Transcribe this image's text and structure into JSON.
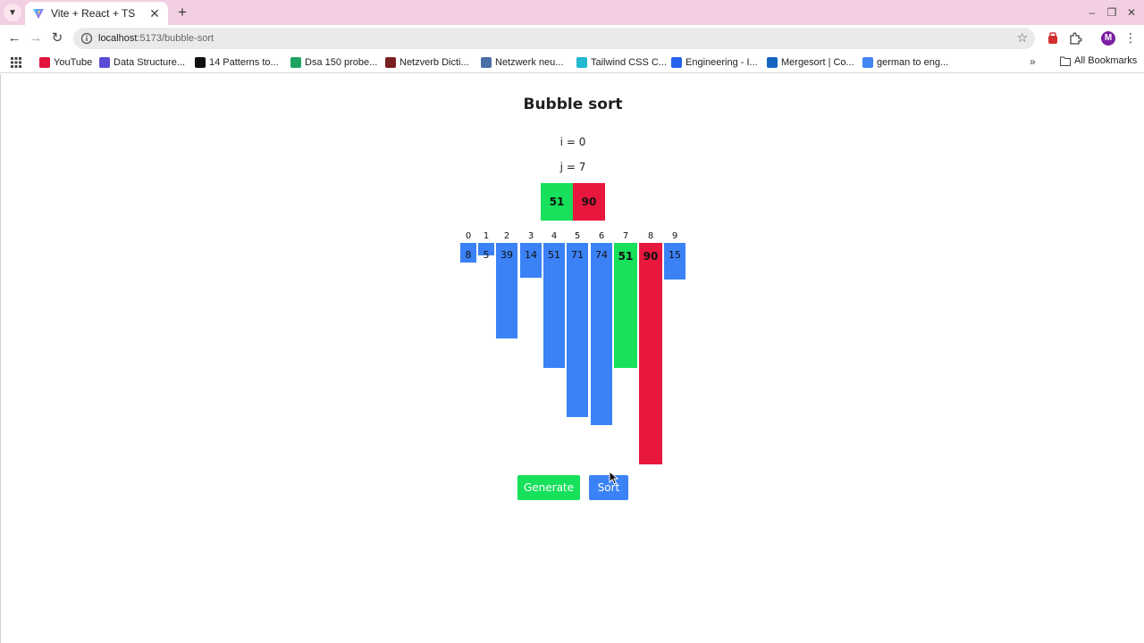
{
  "browser": {
    "tab_title": "Vite + React + TS",
    "url_host": "localhost",
    "url_path": ":5173/bubble-sort",
    "profile_initial": "M",
    "bookmarks": [
      {
        "label": "YouTube",
        "color": "#e0143c"
      },
      {
        "label": "Data Structure...",
        "color": "#5b4cd6"
      },
      {
        "label": "14 Patterns to...",
        "color": "#111111"
      },
      {
        "label": "Dsa 150 probe...",
        "color": "#1ea362"
      },
      {
        "label": "Netzverb Dicti...",
        "color": "#7a1f1f"
      },
      {
        "label": "Netzwerk neu...",
        "color": "#4a6fa5"
      },
      {
        "label": "Tailwind CSS C...",
        "color": "#22b8cf"
      },
      {
        "label": "Engineering - I...",
        "color": "#2563eb"
      },
      {
        "label": "Mergesort | Co...",
        "color": "#1565c0"
      },
      {
        "label": "german to eng...",
        "color": "#4285f4"
      }
    ],
    "all_bookmarks_label": "All Bookmarks"
  },
  "app": {
    "title": "Bubble sort",
    "i_label": "i = 0",
    "j_label": "j = 7",
    "compare": [
      {
        "value": "51",
        "color": "#17e05a"
      },
      {
        "value": "90",
        "color": "#e8173d"
      }
    ],
    "colors": {
      "default": "#3b82f6",
      "current": "#17e05a",
      "next": "#e8173d"
    },
    "array": [
      {
        "index": "0",
        "value": "8",
        "state": "default"
      },
      {
        "index": "1",
        "value": "5",
        "state": "default"
      },
      {
        "index": "2",
        "value": "39",
        "state": "default"
      },
      {
        "index": "3",
        "value": "14",
        "state": "default"
      },
      {
        "index": "4",
        "value": "51",
        "state": "default"
      },
      {
        "index": "5",
        "value": "71",
        "state": "default"
      },
      {
        "index": "6",
        "value": "74",
        "state": "default"
      },
      {
        "index": "7",
        "value": "51",
        "state": "current"
      },
      {
        "index": "8",
        "value": "90",
        "state": "next"
      },
      {
        "index": "9",
        "value": "15",
        "state": "default"
      }
    ],
    "buttons": {
      "generate": "Generate",
      "sort": "Sort"
    }
  }
}
